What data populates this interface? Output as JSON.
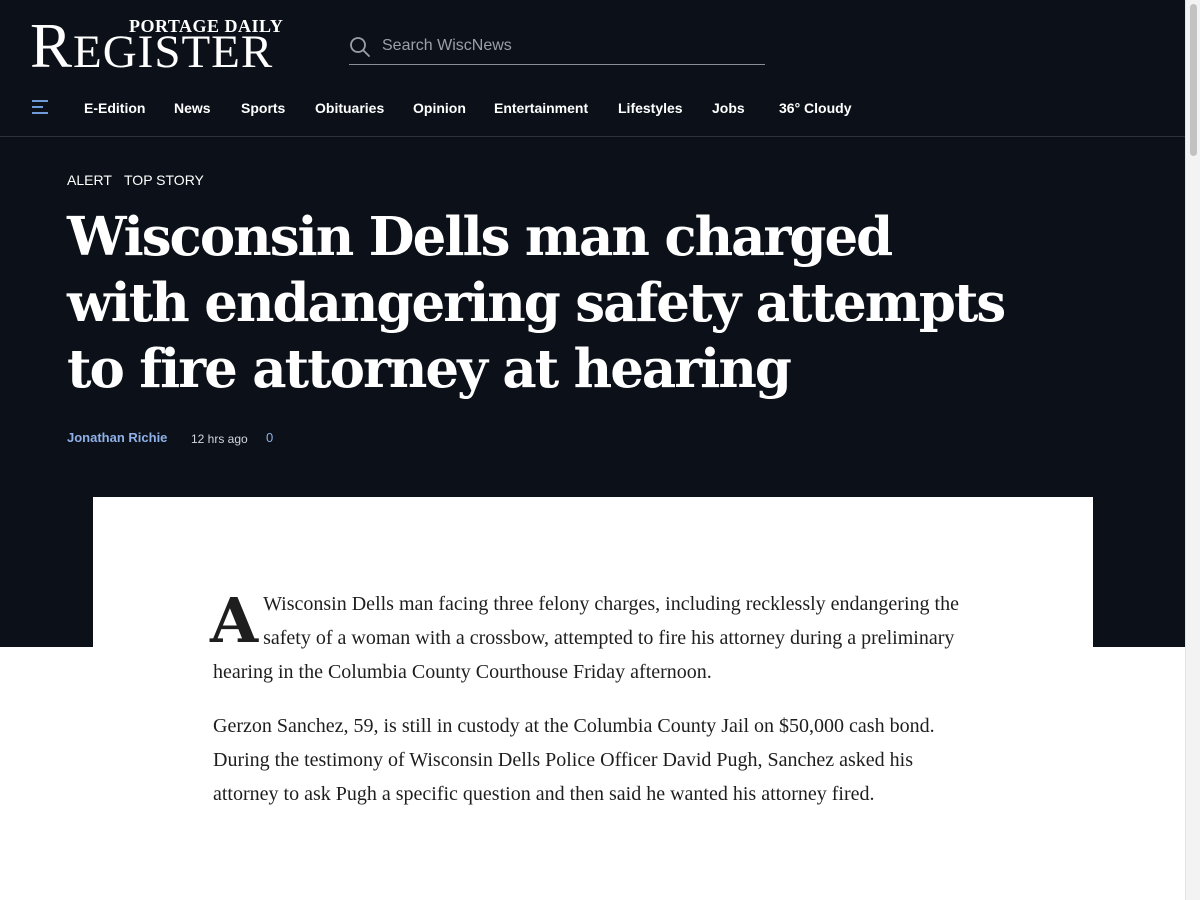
{
  "header": {
    "logo_top": "PORTAGE DAILY",
    "logo_main_r": "R",
    "logo_main_rest": "EGISTER",
    "search_placeholder": "Search WiscNews"
  },
  "nav": {
    "items": [
      "E-Edition",
      "News",
      "Sports",
      "Obituaries",
      "Opinion",
      "Entertainment",
      "Lifestyles",
      "Jobs"
    ],
    "weather": "36° Cloudy"
  },
  "article": {
    "kickers": [
      "ALERT",
      "TOP STORY"
    ],
    "headline": "Wisconsin Dells man charged with endangering safety attempts to fire attorney at hearing",
    "author": "Jonathan Richie",
    "time": "12 hrs ago",
    "comments": "0",
    "dropcap": "A",
    "paragraph1": "Wisconsin Dells man facing three felony charges, including recklessly endangering the safety of a woman with a crossbow, attempted to fire his attorney during a preliminary hearing in the Columbia County Courthouse Friday afternoon.",
    "paragraph2": "Gerzon Sanchez, 59, is still in custody at the Columbia County Jail on $50,000 cash bond. During the testimony of Wisconsin Dells Police Officer David Pugh, Sanchez asked his attorney to ask Pugh a specific question and then said he wanted his attorney fired."
  },
  "colors": {
    "header_bg": "#0c1119",
    "link_blue": "#8fb0e8",
    "menu_icon": "#6f9ad8"
  },
  "icons": {
    "menu": "hamburger-menu-icon",
    "search": "search-icon"
  }
}
